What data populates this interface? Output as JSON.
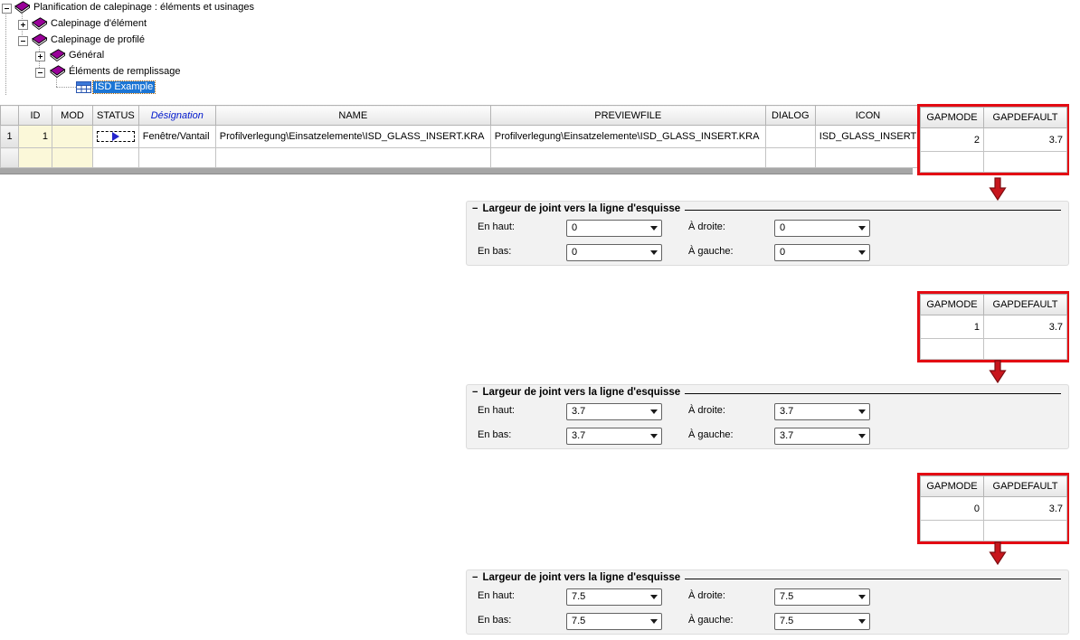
{
  "tree": {
    "items": [
      {
        "label": "Planification de calepinage : éléments et usinages",
        "state": "expanded",
        "icon": "book"
      },
      {
        "label": "Calepinage d'élément",
        "state": "collapsed",
        "icon": "book"
      },
      {
        "label": "Calepinage de profilé",
        "state": "expanded",
        "icon": "book"
      },
      {
        "label": "Général",
        "state": "collapsed",
        "icon": "book"
      },
      {
        "label": "Éléments de remplissage",
        "state": "expanded",
        "icon": "book"
      },
      {
        "label": "ISD Example",
        "state": "leaf",
        "icon": "table",
        "selected": true
      }
    ]
  },
  "grid": {
    "headers": {
      "id": "ID",
      "mod": "MOD",
      "status": "STATUS",
      "designation": "Désignation",
      "name": "NAME",
      "previewfile": "PREVIEWFILE",
      "dialog": "DIALOG",
      "icon": "ICON"
    },
    "gap_headers": {
      "gapmode": "GAPMODE",
      "gapdefault": "GAPDEFAULT"
    },
    "row": {
      "num": "1",
      "id": "1",
      "mod": "",
      "status": "play-indicator",
      "designation": "Fenêtre/Vantail",
      "name": "Profilverlegung\\Einsatzelemente\\ISD_GLASS_INSERT.KRA",
      "previewfile": "Profilverlegung\\Einsatzelemente\\ISD_GLASS_INSERT.KRA",
      "dialog": "",
      "icon": "ISD_GLASS_INSERT"
    }
  },
  "gap_tables": [
    {
      "gapmode": "2",
      "gapdefault": "3.7"
    },
    {
      "gapmode": "1",
      "gapdefault": "3.7"
    },
    {
      "gapmode": "0",
      "gapdefault": "3.7"
    }
  ],
  "panels": [
    {
      "collapse_glyph": "−",
      "title": "Largeur de joint vers la ligne d'esquisse",
      "fields": [
        {
          "label": "En haut:",
          "value": "0"
        },
        {
          "label": "À droite:",
          "value": "0"
        },
        {
          "label": "En bas:",
          "value": "0"
        },
        {
          "label": "À gauche:",
          "value": "0"
        }
      ]
    },
    {
      "collapse_glyph": "−",
      "title": "Largeur de joint vers la ligne d'esquisse",
      "fields": [
        {
          "label": "En haut:",
          "value": "3.7"
        },
        {
          "label": "À droite:",
          "value": "3.7"
        },
        {
          "label": "En bas:",
          "value": "3.7"
        },
        {
          "label": "À gauche:",
          "value": "3.7"
        }
      ]
    },
    {
      "collapse_glyph": "−",
      "title": "Largeur de joint vers la ligne d'esquisse",
      "fields": [
        {
          "label": "En haut:",
          "value": "7.5"
        },
        {
          "label": "À droite:",
          "value": "7.5"
        },
        {
          "label": "En bas:",
          "value": "7.5"
        },
        {
          "label": "À gauche:",
          "value": "7.5"
        }
      ]
    }
  ],
  "colors": {
    "annotation_red": "#e30b13",
    "tree_selection_blue": "#1b75d5",
    "book_icon_purple": "#990099",
    "sorted_header_blue": "#0018cc",
    "cell_yellow": "#fbf8d9",
    "status_triangle_blue": "#2323cc"
  }
}
